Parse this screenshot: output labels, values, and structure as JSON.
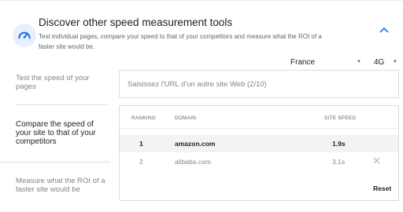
{
  "header": {
    "title": "Discover other speed measurement tools",
    "subtitle": "Test individual pages, compare your speed to that of your competitors and measure what the ROI of a faster site would be.",
    "icon": "speedometer-icon",
    "collapse_icon": "chevron-up-icon",
    "accent": "#1a73e8"
  },
  "filters": {
    "country": "France",
    "network": "4G"
  },
  "nav": {
    "items": [
      {
        "label": "Test the speed of your pages"
      },
      {
        "label": "Compare the speed of your site to that of your competitors"
      },
      {
        "label": "Measure what the ROI of a faster site would be"
      }
    ]
  },
  "compare": {
    "url_placeholder": "Saisissez l'URL d'un autre site Web (2/10)",
    "columns": {
      "ranking": "RANKING",
      "domain": "DOMAIN",
      "speed": "SITE SPEED"
    },
    "rows": [
      {
        "rank": "1",
        "domain": "amazon.com",
        "speed": "1.9s"
      },
      {
        "rank": "2",
        "domain": "alibaba.com",
        "speed": "3.1s"
      }
    ],
    "reset_label": "Reset"
  }
}
